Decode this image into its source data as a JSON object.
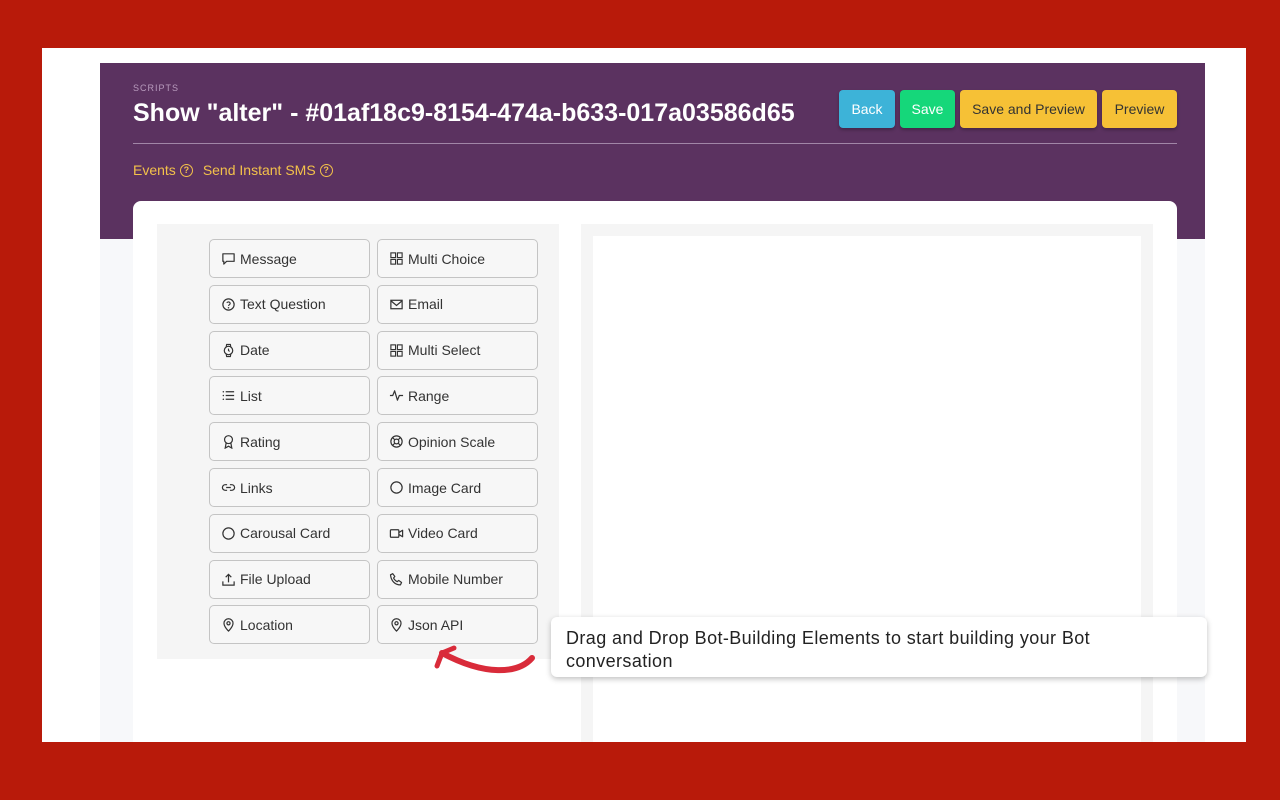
{
  "header": {
    "breadcrumb": "SCRIPTS",
    "title": "Show \"alter\" - #01af18c9-8154-474a-b633-017a03586d65",
    "buttons": {
      "back": "Back",
      "save": "Save",
      "save_preview": "Save and Preview",
      "preview": "Preview"
    },
    "tabs": [
      {
        "label": "Events",
        "icon": "help-circle-icon"
      },
      {
        "label": "Send Instant SMS",
        "icon": "help-circle-icon"
      }
    ]
  },
  "elements": [
    {
      "label": "Message",
      "icon": "message-icon"
    },
    {
      "label": "Multi Choice",
      "icon": "grid-icon"
    },
    {
      "label": "Text Question",
      "icon": "help-circle-icon"
    },
    {
      "label": "Email",
      "icon": "mail-icon"
    },
    {
      "label": "Date",
      "icon": "watch-icon"
    },
    {
      "label": "Multi Select",
      "icon": "grid-icon"
    },
    {
      "label": "List",
      "icon": "list-icon"
    },
    {
      "label": "Range",
      "icon": "activity-icon"
    },
    {
      "label": "Rating",
      "icon": "award-icon"
    },
    {
      "label": "Opinion Scale",
      "icon": "life-buoy-icon"
    },
    {
      "label": "Links",
      "icon": "link-icon"
    },
    {
      "label": "Image Card",
      "icon": "circle-icon"
    },
    {
      "label": "Carousal Card",
      "icon": "circle-icon"
    },
    {
      "label": "Video Card",
      "icon": "video-icon"
    },
    {
      "label": "File Upload",
      "icon": "upload-icon"
    },
    {
      "label": "Mobile Number",
      "icon": "phone-icon"
    },
    {
      "label": "Location",
      "icon": "map-pin-icon"
    },
    {
      "label": "Json API",
      "icon": "map-pin-icon"
    }
  ],
  "tooltip": {
    "text": "Drag and Drop Bot-Building Elements to start building your Bot conversation"
  },
  "colors": {
    "frame_border": "#b81a0a",
    "header_bg": "#5b3260",
    "back": "#3db3d8",
    "save": "#15d77a",
    "preview": "#f6c136",
    "tab_text": "#f3c14a",
    "arrow": "#d92b3a"
  }
}
